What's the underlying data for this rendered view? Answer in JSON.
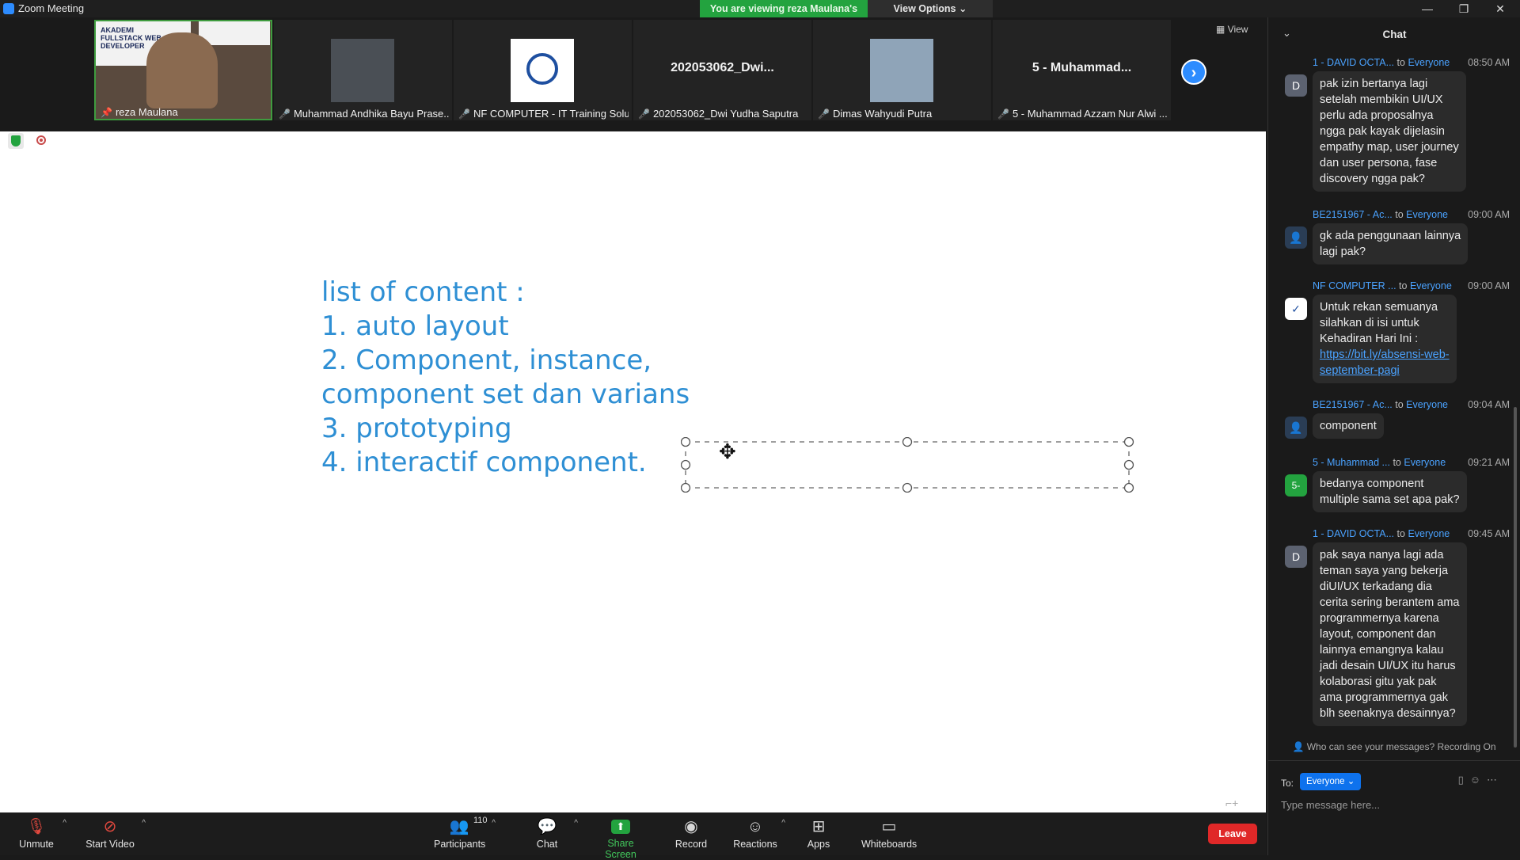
{
  "window": {
    "title": "Zoom Meeting",
    "viewing_banner": "You are viewing reza Maulana's screen",
    "view_options": "View Options ⌄",
    "minimize": "—",
    "restore": "❐",
    "close": "✕"
  },
  "gallery": {
    "view_label": "View",
    "tiles": [
      {
        "name": "reza Maulana",
        "big": "",
        "muted": false
      },
      {
        "name": "Muhammad Andhika Bayu Prase...",
        "big": "",
        "muted": true
      },
      {
        "name": "NF COMPUTER - IT Training Solu...",
        "big": "",
        "muted": true
      },
      {
        "name": "202053062_Dwi Yudha Saputra",
        "big": "202053062_Dwi...",
        "muted": true
      },
      {
        "name": "Dimas Wahyudi Putra",
        "big": "",
        "muted": true
      },
      {
        "name": "5 - Muhammad Azzam Nur Alwi ...",
        "big": "5 - Muhammad...",
        "muted": true
      }
    ],
    "tile0_banner": "AKADEMI FULLSTACK WEB DEVELOPER",
    "next_icon": "›"
  },
  "slide": {
    "lines": [
      "list of content :",
      "1. auto layout",
      "2. Component, instance,",
      "component set dan varians",
      "3. prototyping",
      "4. interactif component."
    ]
  },
  "toolbar": {
    "unmute": "Unmute",
    "start_video": "Start Video",
    "participants": "Participants",
    "participants_count": "110",
    "chat": "Chat",
    "share_screen": "Share Screen",
    "record": "Record",
    "reactions": "Reactions",
    "apps": "Apps",
    "whiteboards": "Whiteboards",
    "leave": "Leave"
  },
  "chat": {
    "title": "Chat",
    "messages": [
      {
        "from": "1 - DAVID OCTA...",
        "to": "to",
        "target": "Everyone",
        "time": "08:50 AM",
        "avatar": "D",
        "avatar_color": "#5c6270",
        "lines": [
          "pak izin bertanya lagi",
          "setelah membikin UI/UX",
          "perlu ada proposalnya",
          "ngga pak kayak dijelasin",
          "empathy map, user journey",
          "dan user persona, fase",
          "discovery ngga pak?"
        ]
      },
      {
        "from": "BE2151967 - Ac...",
        "to": "to",
        "target": "Everyone",
        "time": "09:00 AM",
        "avatar": "",
        "avatar_color": "#2a3d55",
        "lines": [
          "gk ada penggunaan lainnya",
          "lagi pak?"
        ]
      },
      {
        "from": "NF COMPUTER ...",
        "to": "to",
        "target": "Everyone",
        "time": "09:00 AM",
        "avatar": "",
        "avatar_color": "#ffffff",
        "lines": [
          "Untuk rekan semuanya",
          "silahkan di isi untuk",
          "Kehadiran Hari Ini :"
        ],
        "link": [
          "https://bit.ly/absensi-web-",
          "september-pagi"
        ]
      },
      {
        "from": "BE2151967 - Ac...",
        "to": "to",
        "target": "Everyone",
        "time": "09:04 AM",
        "avatar": "",
        "avatar_color": "#2a3d55",
        "lines": [
          "component"
        ]
      },
      {
        "from": "5 - Muhammad ...",
        "to": "to",
        "target": "Everyone",
        "time": "09:21 AM",
        "avatar": "5-",
        "avatar_color": "#23a33f",
        "lines": [
          "bedanya component",
          "multiple sama set apa pak?"
        ]
      },
      {
        "from": "1 - DAVID OCTA...",
        "to": "to",
        "target": "Everyone",
        "time": "09:45 AM",
        "avatar": "D",
        "avatar_color": "#5c6270",
        "lines": [
          "pak saya nanya lagi ada",
          "teman saya yang bekerja",
          "diUI/UX terkadang dia",
          "cerita sering berantem ama",
          "programmernya karena",
          "layout, component dan",
          "lainnya emangnya kalau",
          "jadi desain UI/UX itu harus",
          "kolaborasi gitu yak pak",
          "ama programmernya gak",
          "blh seenaknya desainnya?"
        ]
      }
    ],
    "who_can_see": "Who can see your messages? Recording On",
    "to_label": "To:",
    "recipient": "Everyone ⌄",
    "placeholder": "Type message here..."
  }
}
